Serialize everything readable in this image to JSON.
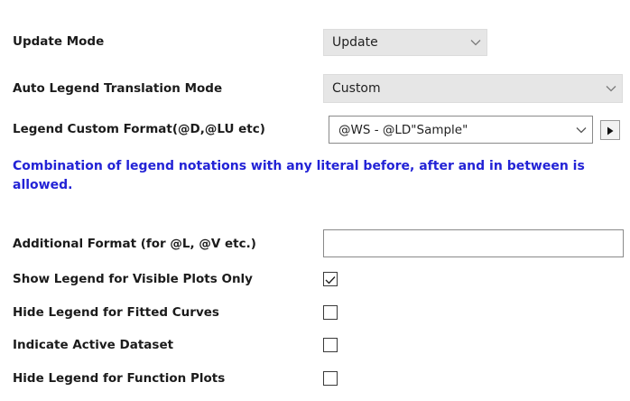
{
  "update_mode": {
    "label": "Update Mode",
    "value": "Update"
  },
  "auto_legend_translation_mode": {
    "label": "Auto Legend Translation Mode",
    "value": "Custom"
  },
  "legend_custom_format": {
    "label": "Legend Custom Format(@D,@LU etc)",
    "value": "@WS - @LD\"Sample\""
  },
  "note": "Combination of legend notations with any literal before, after and in between is allowed.",
  "additional_format": {
    "label": "Additional Format (for @L, @V etc.)",
    "value": ""
  },
  "checkboxes": [
    {
      "label": "Show Legend for Visible Plots Only",
      "checked": true
    },
    {
      "label": "Hide Legend for Fitted Curves",
      "checked": false
    },
    {
      "label": "Indicate Active Dataset",
      "checked": false
    },
    {
      "label": "Hide Legend for Function Plots",
      "checked": false
    }
  ],
  "icons": {
    "dropdown": "chevron-down-icon",
    "expand": "triangle-right-icon",
    "check": "checkmark-icon"
  }
}
